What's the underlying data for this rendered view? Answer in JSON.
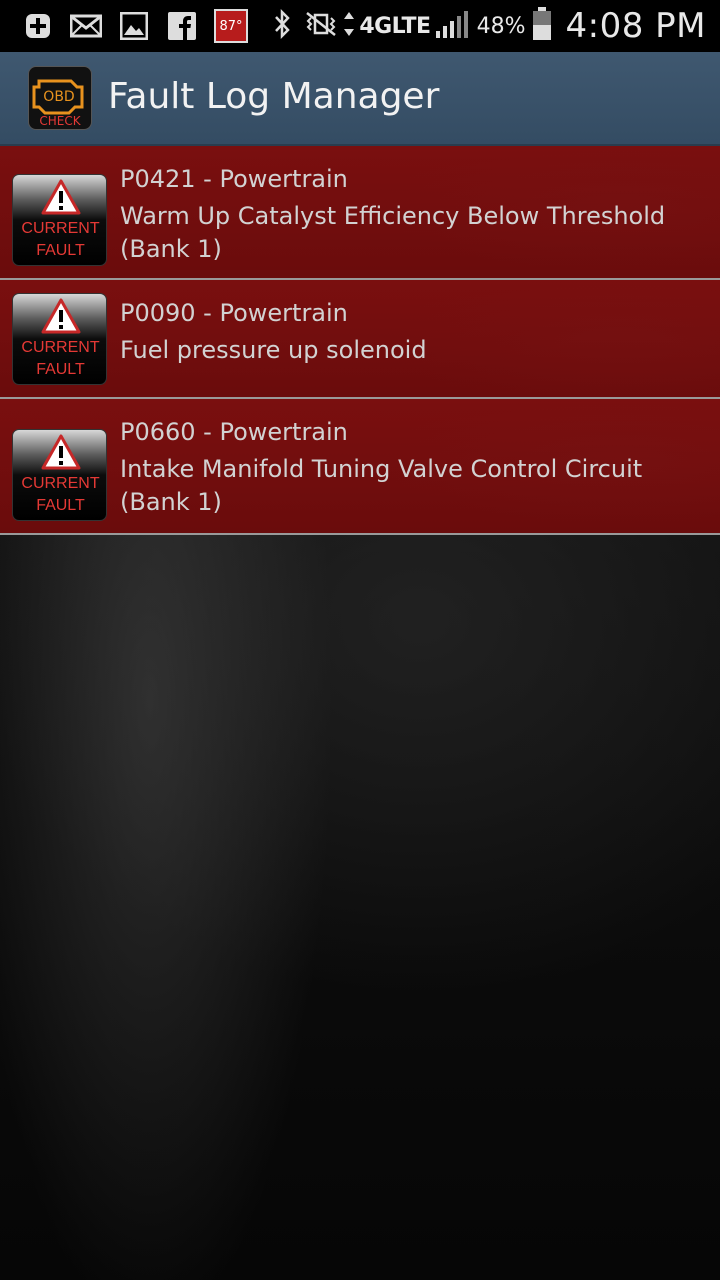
{
  "status_bar": {
    "icons_left": [
      "add-icon",
      "mail-icon",
      "image-icon",
      "facebook-icon"
    ],
    "temperature": "87°",
    "icons_right": [
      "bluetooth-icon",
      "vibrate-mute-icon",
      "signal-icon",
      "battery-icon"
    ],
    "network": "4GLTE",
    "battery": "48%",
    "time": "4:08 PM"
  },
  "app": {
    "title": "Fault Log Manager",
    "icon_text_top": "OBD",
    "icon_text_bottom": "CHECK"
  },
  "faults": [
    {
      "code": "P0421 - Powertrain",
      "description": "Warm Up Catalyst Efficiency Below Threshold (Bank 1)",
      "badge_line1": "CURRENT",
      "badge_line2": "FAULT"
    },
    {
      "code": "P0090 - Powertrain",
      "description": "Fuel pressure up solenoid",
      "badge_line1": "CURRENT",
      "badge_line2": "FAULT"
    },
    {
      "code": "P0660 - Powertrain",
      "description": "Intake Manifold Tuning Valve Control Circuit (Bank 1)",
      "badge_line1": "CURRENT",
      "badge_line2": "FAULT"
    }
  ],
  "colors": {
    "action_bar": "#3f5870",
    "fault_row": "#7a0f0f",
    "badge_text": "#e53935"
  }
}
